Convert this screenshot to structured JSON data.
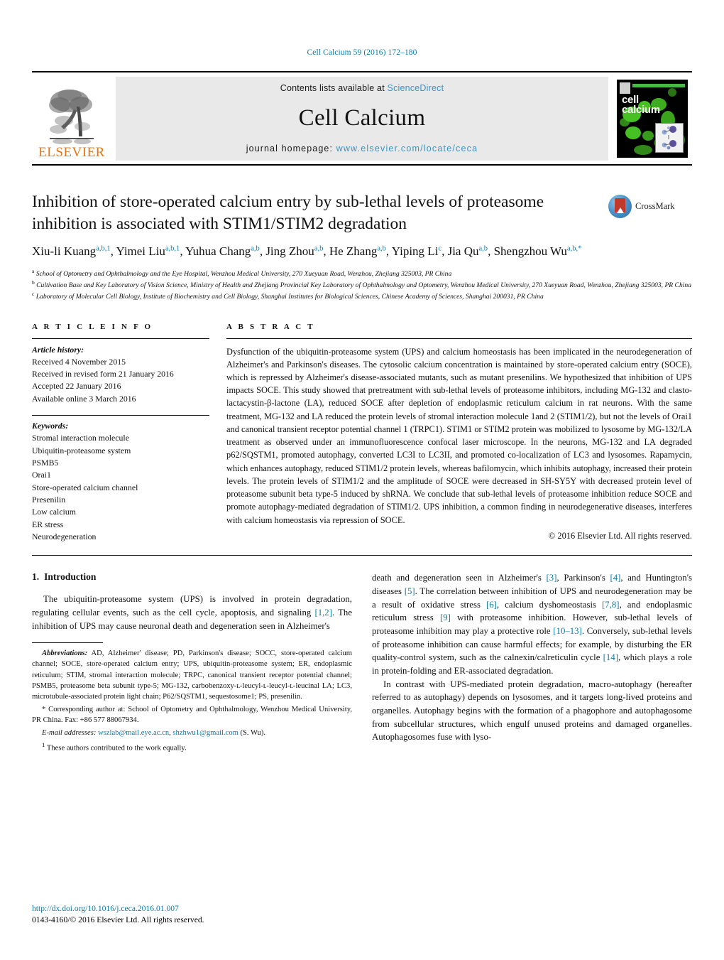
{
  "running_head": "Cell Calcium 59 (2016) 172–180",
  "masthead": {
    "elsevier_wordmark": "ELSEVIER",
    "contents_prefix": "Contents lists available at ",
    "sciencedirect": "ScienceDirect",
    "journal_title": "Cell Calcium",
    "homepage_prefix": "journal homepage: ",
    "homepage_url": "www.elsevier.com/locate/ceca",
    "cover_title_line1": "cell",
    "cover_title_line2": "calcium"
  },
  "article": {
    "title": "Inhibition of store-operated calcium entry by sub-lethal levels of proteasome inhibition is associated with STIM1/STIM2 degradation",
    "crossmark_label": "CrossMark",
    "authors_html": "Xiu-li Kuang<sup>a,b,1</sup>, Yimei Liu<sup>a,b,1</sup>, Yuhua Chang<sup>a,b</sup>, Jing Zhou<sup>a,b</sup>, He Zhang<sup>a,b</sup>, Yiping Li<sup>c</sup>, Jia Qu<sup>a,b</sup>, Shengzhou Wu<sup>a,b,<span class=\"ast\">*</span></sup>",
    "affiliations": [
      {
        "marker": "a",
        "text": "School of Optometry and Ophthalmology and the Eye Hospital, Wenzhou Medical University, 270 Xueyuan Road, Wenzhou, Zhejiang 325003, PR China"
      },
      {
        "marker": "b",
        "text": "Cultivation Base and Key Laboratory of Vision Science, Ministry of Health and Zhejiang Provincial Key Laboratory of Ophthalmology and Optometry, Wenzhou Medical University, 270 Xueyuan Road, Wenzhou, Zhejiang 325003, PR China"
      },
      {
        "marker": "c",
        "text": "Laboratory of Molecular Cell Biology, Institute of Biochemistry and Cell Biology, Shanghai Institutes for Biological Sciences, Chinese Academy of Sciences, Shanghai 200031, PR China"
      }
    ]
  },
  "article_info": {
    "heading": "A R T I C L E   I N F O",
    "history_label": "Article history:",
    "history": [
      "Received 4 November 2015",
      "Received in revised form 21 January 2016",
      "Accepted 22 January 2016",
      "Available online 3 March 2016"
    ],
    "keywords_label": "Keywords:",
    "keywords": [
      "Stromal interaction molecule",
      "Ubiquitin-proteasome system",
      "PSMB5",
      "Orai1",
      "Store-operated calcium channel",
      "Presenilin",
      "Low calcium",
      "ER stress",
      "Neurodegeneration"
    ]
  },
  "abstract": {
    "heading": "A B S T R A C T",
    "text": "Dysfunction of the ubiquitin-proteasome system (UPS) and calcium homeostasis has been implicated in the neurodegeneration of Alzheimer's and Parkinson's diseases. The cytosolic calcium concentration is maintained by store-operated calcium entry (SOCE), which is repressed by Alzheimer's disease-associated mutants, such as mutant presenilins. We hypothesized that inhibition of UPS impacts SOCE. This study showed that pretreatment with sub-lethal levels of proteasome inhibitors, including MG-132 and clasto-lactacystin-β-lactone (LA), reduced SOCE after depletion of endoplasmic reticulum calcium in rat neurons. With the same treatment, MG-132 and LA reduced the protein levels of stromal interaction molecule 1and 2 (STIM1/2), but not the levels of Orai1 and canonical transient receptor potential channel 1 (TRPC1). STIM1 or STIM2 protein was mobilized to lysosome by MG-132/LA treatment as observed under an immunofluorescence confocal laser microscope. In the neurons, MG-132 and LA degraded p62/SQSTM1, promoted autophagy, converted LC3I to LC3II, and promoted co-localization of LC3 and lysosomes. Rapamycin, which enhances autophagy, reduced STIM1/2 protein levels, whereas bafilomycin, which inhibits autophagy, increased their protein levels. The protein levels of STIM1/2 and the amplitude of SOCE were decreased in SH-SY5Y with decreased protein level of proteasome subunit beta type-5 induced by shRNA. We conclude that sub-lethal levels of proteasome inhibition reduce SOCE and promote autophagy-mediated degradation of STIM1/2. UPS inhibition, a common finding in neurodegenerative diseases, interferes with calcium homeostasis via repression of SOCE.",
    "copyright": "© 2016 Elsevier Ltd. All rights reserved."
  },
  "introduction": {
    "number": "1.",
    "heading": "Introduction",
    "para1_a": "The ubiquitin-proteasome system (UPS) is involved in protein degradation, regulating cellular events, such as the cell cycle, apoptosis, and signaling ",
    "para1_ref1": "[1,2]",
    "para1_b": ". The inhibition of UPS may cause neuronal death and degeneration seen in Alzheimer's ",
    "para1_ref2": "[3]",
    "para1_c": ", Parkinson's ",
    "para1_ref3": "[4]",
    "para1_d": ", and Huntington's diseases ",
    "para1_ref4": "[5]",
    "para1_e": ". The correlation between inhibition of UPS and neurodegeneration may be a result of oxidative stress ",
    "para1_ref5": "[6]",
    "para1_f": ", calcium dyshomeostasis ",
    "para1_ref6": "[7,8]",
    "para1_g": ", and endoplasmic reticulum stress ",
    "para1_ref7": "[9]",
    "para1_h": " with proteasome inhibition. However, sub-lethal levels of proteasome inhibition may play a protective role ",
    "para1_ref8": "[10–13]",
    "para1_i": ". Conversely, sub-lethal levels of proteasome inhibition can cause harmful effects; for example, by disturbing the ER quality-control system, such as the calnexin/calreticulin cycle ",
    "para1_ref9": "[14]",
    "para1_j": ", which plays a role in protein-folding and ER-associated degradation.",
    "para2": "In contrast with UPS-mediated protein degradation, macro-autophagy (hereafter referred to as autophagy) depends on lysosomes, and it targets long-lived proteins and organelles. Autophagy begins with the formation of a phagophore and autophagosome from subcellular structures, which engulf unused proteins and damaged organelles. Autophagosomes fuse with lyso-"
  },
  "footnotes": {
    "abbrev_label": "Abbreviations:",
    "abbrev_text": " AD, Alzheimer' disease; PD, Parkinson's disease; SOCC, store-operated calcium channel; SOCE, store-operated calcium entry; UPS, ubiquitin-proteasome system; ER, endoplasmic reticulum; STIM, stromal interaction molecule; TRPC, canonical transient receptor potential channel; PSMB5, proteasome beta subunit type-5; MG-132, carbobenzoxy-ʟ-leucyl-ʟ-leucyl-ʟ-leucinal LA; LC3, microtubule-associated protein light chain; P62/SQSTM1, sequestosome1; PS, presenilin.",
    "corresponding_marker": "*",
    "corresponding_text": " Corresponding author at: School of Optometry and Ophthalmology, Wenzhou Medical University, PR China. Fax: +86 577 88067934.",
    "email_label": "E-mail addresses:",
    "email1": "wszlab@mail.eye.ac.cn",
    "email_sep": ", ",
    "email2": "shzhwu1@gmail.com",
    "email_suffix": " (S. Wu).",
    "equal_marker": "1",
    "equal_text": " These authors contributed to the work equally."
  },
  "footer": {
    "doi": "http://dx.doi.org/10.1016/j.ceca.2016.01.007",
    "issn_line": "0143-4160/© 2016 Elsevier Ltd. All rights reserved."
  },
  "colors": {
    "link": "#0b7aa5",
    "sciencedirect": "#3a94c4",
    "elsevier_orange": "#e87511",
    "masthead_gray": "#e9e9e9"
  }
}
